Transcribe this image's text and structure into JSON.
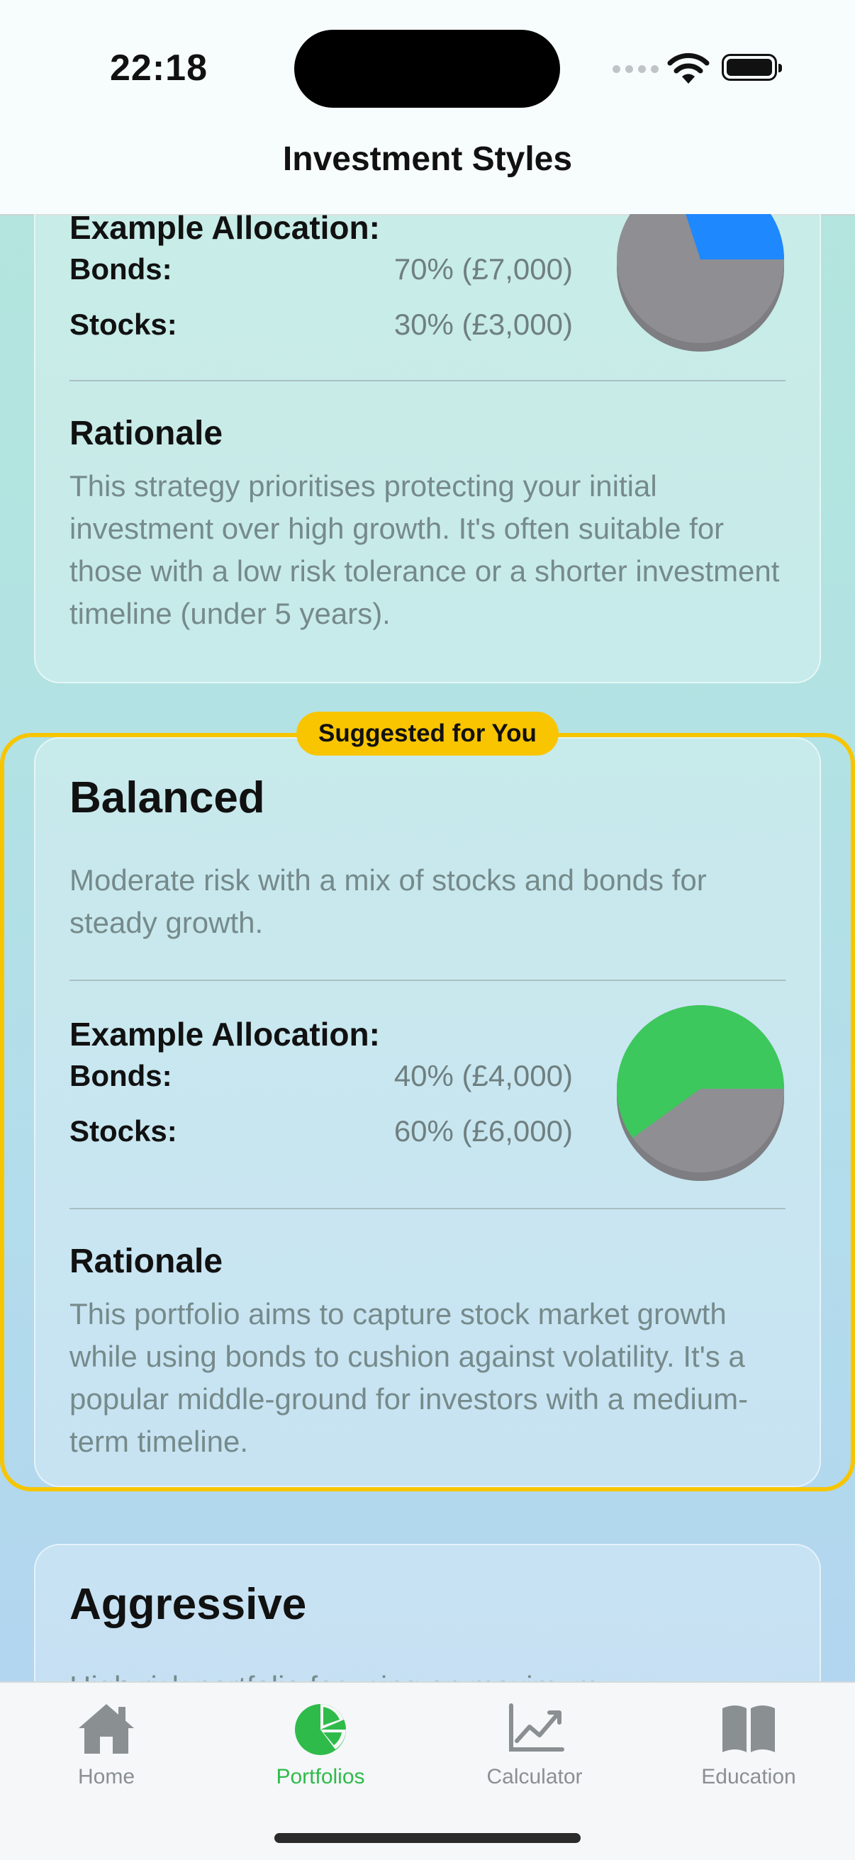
{
  "status": {
    "time": "22:18"
  },
  "header": {
    "title": "Investment Styles"
  },
  "card_conservative": {
    "alloc_heading": "Example Allocation:",
    "bonds_label": "Bonds:",
    "bonds_value": "70% (£7,000)",
    "stocks_label": "Stocks:",
    "stocks_value": "30% (£3,000)",
    "rationale_heading": "Rationale",
    "rationale": "This strategy prioritises protecting your initial investment over high growth. It's often suitable for those with a low risk tolerance or a shorter investment timeline (under 5 years).",
    "pie": {
      "bonds_fraction": 0.7,
      "stocks_fraction": 0.3,
      "stocks_color": "#1e88ff",
      "bonds_color": "#8e8e93"
    }
  },
  "suggested_badge": "Suggested for You",
  "card_balanced": {
    "title": "Balanced",
    "description": "Moderate risk with a mix of stocks and bonds for steady growth.",
    "alloc_heading": "Example Allocation:",
    "bonds_label": "Bonds:",
    "bonds_value": "40% (£4,000)",
    "stocks_label": "Stocks:",
    "stocks_value": "60% (£6,000)",
    "rationale_heading": "Rationale",
    "rationale": "This portfolio aims to capture stock market growth while using bonds to cushion against volatility. It's a popular middle-ground for investors with a medium-term timeline.",
    "pie": {
      "bonds_fraction": 0.4,
      "stocks_fraction": 0.6,
      "stocks_color": "#3cc85c",
      "bonds_color": "#8e8e93"
    }
  },
  "card_aggressive": {
    "title": "Aggressive",
    "description_partial": "High-risk portfolio focusing on maximum"
  },
  "tabs": [
    {
      "label": "Home",
      "icon": "house-icon"
    },
    {
      "label": "Portfolios",
      "icon": "pie-chart-icon",
      "active": true
    },
    {
      "label": "Calculator",
      "icon": "chart-line-icon"
    },
    {
      "label": "Education",
      "icon": "book-icon"
    }
  ],
  "colors": {
    "accent": "#2fbb4a",
    "highlight": "#f7c500"
  }
}
